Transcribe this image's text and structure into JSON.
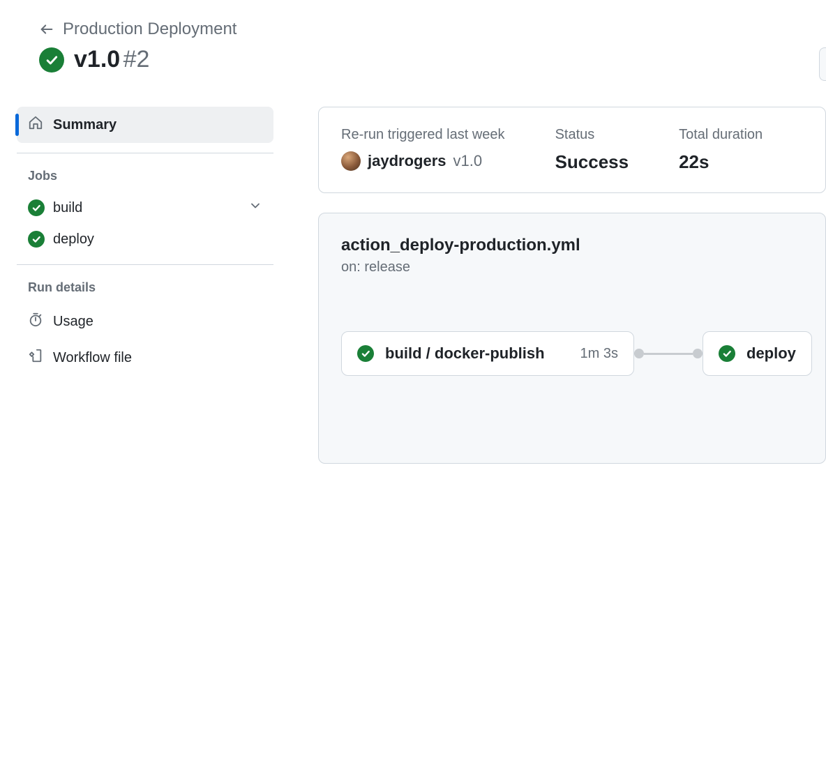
{
  "breadcrumb": {
    "workflow_name": "Production Deployment"
  },
  "header": {
    "version": "v1.0",
    "run_number": "#2"
  },
  "sidebar": {
    "summary_label": "Summary",
    "jobs_section_label": "Jobs",
    "jobs": [
      {
        "name": "build",
        "status": "success",
        "expandable": true
      },
      {
        "name": "deploy",
        "status": "success",
        "expandable": false
      }
    ],
    "run_details_label": "Run details",
    "usage_label": "Usage",
    "workflow_file_label": "Workflow file"
  },
  "summary": {
    "triggered_label": "Re-run triggered last week",
    "actor": "jaydrogers",
    "actor_ref": "v1.0",
    "status_label": "Status",
    "status_value": "Success",
    "duration_label": "Total duration",
    "duration_value": "22s"
  },
  "workflow": {
    "filename": "action_deploy-production.yml",
    "trigger": "on: release",
    "graph": [
      {
        "name": "build / docker-publish",
        "duration": "1m 3s",
        "status": "success"
      },
      {
        "name": "deploy",
        "duration": "",
        "status": "success"
      }
    ]
  }
}
